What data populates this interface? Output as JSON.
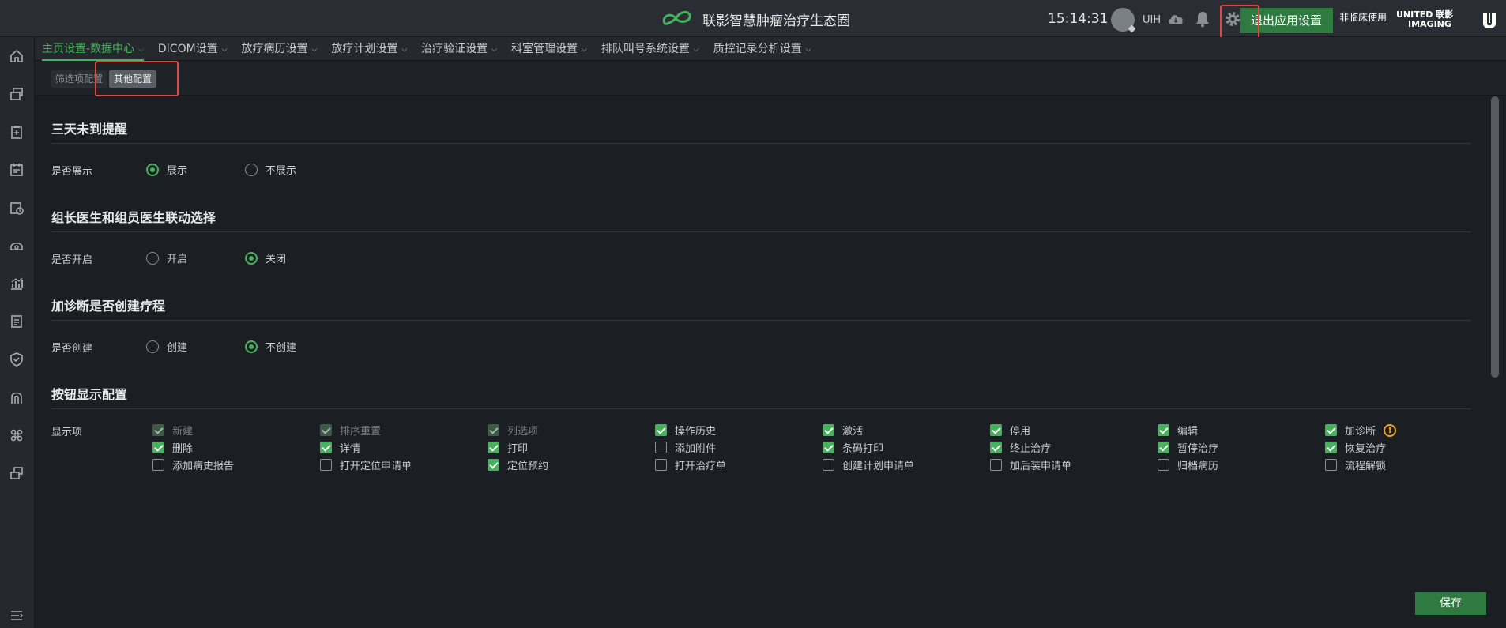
{
  "app": {
    "title": "联影智慧肿瘤治疗生态圈"
  },
  "header": {
    "time": "15:14:31",
    "username": "UIH",
    "exit_label": "退出应用设置",
    "non_clinical": "非临床使用",
    "vendor_line1": "UNITED 联影",
    "vendor_line2": "IMAGING"
  },
  "nav": {
    "tabs": [
      {
        "label": "主页设置-数据中心"
      },
      {
        "label": "DICOM设置"
      },
      {
        "label": "放疗病历设置"
      },
      {
        "label": "放疗计划设置"
      },
      {
        "label": "治疗验证设置"
      },
      {
        "label": "科室管理设置"
      },
      {
        "label": "排队叫号系统设置"
      },
      {
        "label": "质控记录分析设置"
      }
    ]
  },
  "subtabs": [
    {
      "label": "筛选项配置"
    },
    {
      "label": "其他配置"
    }
  ],
  "sections": {
    "remind": {
      "title": "三天未到提醒",
      "label": "是否展示",
      "opt1": "展示",
      "opt2": "不展示"
    },
    "linkage": {
      "title": "组长医生和组员医生联动选择",
      "label": "是否开启",
      "opt1": "开启",
      "opt2": "关闭"
    },
    "course": {
      "title": "加诊断是否创建疗程",
      "label": "是否创建",
      "opt1": "创建",
      "opt2": "不创建"
    },
    "buttons": {
      "title": "按钮显示配置",
      "label": "显示项",
      "items": [
        {
          "label": "新建",
          "checked": true,
          "disabled": true
        },
        {
          "label": "排序重置",
          "checked": true,
          "disabled": true
        },
        {
          "label": "列选项",
          "checked": true,
          "disabled": true
        },
        {
          "label": "操作历史",
          "checked": true,
          "disabled": false
        },
        {
          "label": "激活",
          "checked": true,
          "disabled": false
        },
        {
          "label": "停用",
          "checked": true,
          "disabled": false
        },
        {
          "label": "编辑",
          "checked": true,
          "disabled": false
        },
        {
          "label": "加诊断",
          "checked": true,
          "disabled": false
        },
        {
          "label": "删除",
          "checked": true,
          "disabled": false
        },
        {
          "label": "详情",
          "checked": true,
          "disabled": false
        },
        {
          "label": "打印",
          "checked": true,
          "disabled": false
        },
        {
          "label": "添加附件",
          "checked": false,
          "disabled": false
        },
        {
          "label": "条码打印",
          "checked": true,
          "disabled": false
        },
        {
          "label": "终止治疗",
          "checked": true,
          "disabled": false
        },
        {
          "label": "暂停治疗",
          "checked": true,
          "disabled": false
        },
        {
          "label": "恢复治疗",
          "checked": true,
          "disabled": false
        },
        {
          "label": "添加病史报告",
          "checked": false,
          "disabled": false
        },
        {
          "label": "打开定位申请单",
          "checked": false,
          "disabled": false
        },
        {
          "label": "定位预约",
          "checked": true,
          "disabled": false
        },
        {
          "label": "打开治疗单",
          "checked": false,
          "disabled": false
        },
        {
          "label": "创建计划申请单",
          "checked": false,
          "disabled": false
        },
        {
          "label": "加后装申请单",
          "checked": false,
          "disabled": false
        },
        {
          "label": "归档病历",
          "checked": false,
          "disabled": false
        },
        {
          "label": "流程解锁",
          "checked": false,
          "disabled": false
        }
      ]
    }
  },
  "actions": {
    "save_label": "保存"
  },
  "colors": {
    "accent": "#44b35c",
    "button": "#2e7a40",
    "warning": "#f0a31a",
    "annotation": "#e54545"
  }
}
